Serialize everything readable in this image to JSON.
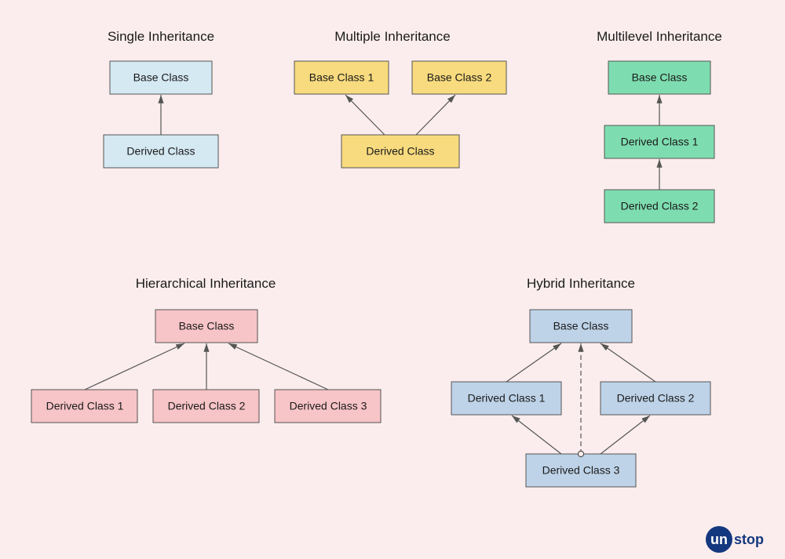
{
  "single": {
    "title": "Single Inheritance",
    "base": "Base Class",
    "derived": "Derived Class",
    "color": "#d5e9f3"
  },
  "multiple": {
    "title": "Multiple Inheritance",
    "base1": "Base Class 1",
    "base2": "Base Class 2",
    "derived": "Derived Class",
    "color": "#f8db7e"
  },
  "multilevel": {
    "title": "Multilevel Inheritance",
    "base": "Base Class",
    "d1": "Derived Class 1",
    "d2": "Derived Class 2",
    "color": "#7eddb0"
  },
  "hierarchical": {
    "title": "Hierarchical Inheritance",
    "base": "Base Class",
    "d1": "Derived Class 1",
    "d2": "Derived Class 2",
    "d3": "Derived Class 3",
    "color": "#f7c4c7"
  },
  "hybrid": {
    "title": "Hybrid Inheritance",
    "base": "Base Class",
    "d1": "Derived Class 1",
    "d2": "Derived Class 2",
    "d3": "Derived Class 3",
    "color": "#bed3e8"
  },
  "logo": {
    "un": "un",
    "stop": "stop"
  }
}
